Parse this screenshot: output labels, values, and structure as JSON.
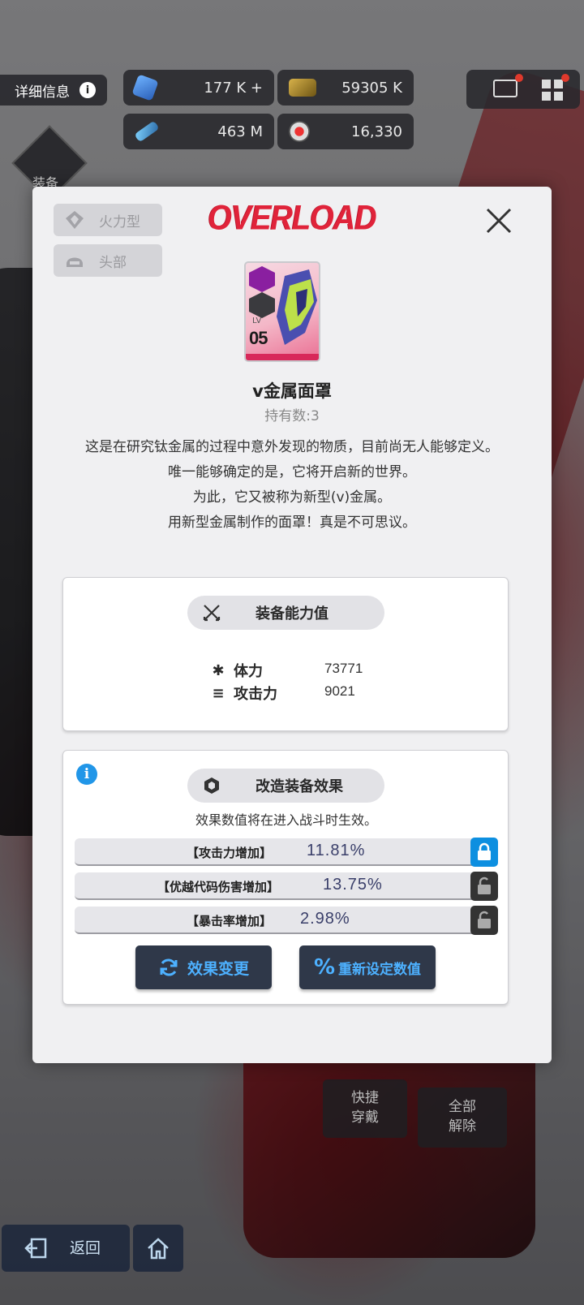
{
  "topbar": {
    "info_label": "详细信息",
    "info_icon": "info-icon",
    "resources": [
      {
        "icon": "crystal-icon",
        "value": "177 K +"
      },
      {
        "icon": "card-icon",
        "value": "59305 K"
      },
      {
        "icon": "battery-icon",
        "value": "463 M"
      },
      {
        "icon": "core-icon",
        "value": "16,330"
      }
    ],
    "equip_label": "装备"
  },
  "bottom": {
    "quick_equip": "快捷\n穿戴",
    "remove_all": "全部\n解除",
    "back": "返回"
  },
  "modal": {
    "chips": {
      "type": "火力型",
      "slot": "头部"
    },
    "logo": "OVERLOAD",
    "item": {
      "level": "05",
      "lv_label": "LV",
      "name": "v金属面罩",
      "hold_count": "持有数:3",
      "description": [
        "这是在研究钛金属的过程中意外发现的物质，目前尚无人能够定义。",
        "唯一能够确定的是，它将开启新的世界。",
        "为此，它又被称为新型(v)金属。",
        "用新型金属制作的面罩！真是不可思议。"
      ]
    },
    "stats_panel": {
      "title": "装备能力值",
      "stats": [
        {
          "label": "体力",
          "value": "73771"
        },
        {
          "label": "攻击力",
          "value": "9021"
        }
      ]
    },
    "effects_panel": {
      "title": "改造装备效果",
      "note": "效果数值将在进入战斗时生效。",
      "effects": [
        {
          "name": "【攻击力增加】",
          "value": "11.81%",
          "locked": true
        },
        {
          "name": "【优越代码伤害增加】",
          "value": "13.75%",
          "locked": false
        },
        {
          "name": "【暴击率增加】",
          "value": "2.98%",
          "locked": false
        }
      ],
      "change_button": "效果变更",
      "reset_button": "重新设定数值"
    }
  },
  "colors": {
    "accent_blue": "#0d8fe0",
    "overload_red": "#e0233a",
    "button_dark": "#2f3849"
  }
}
